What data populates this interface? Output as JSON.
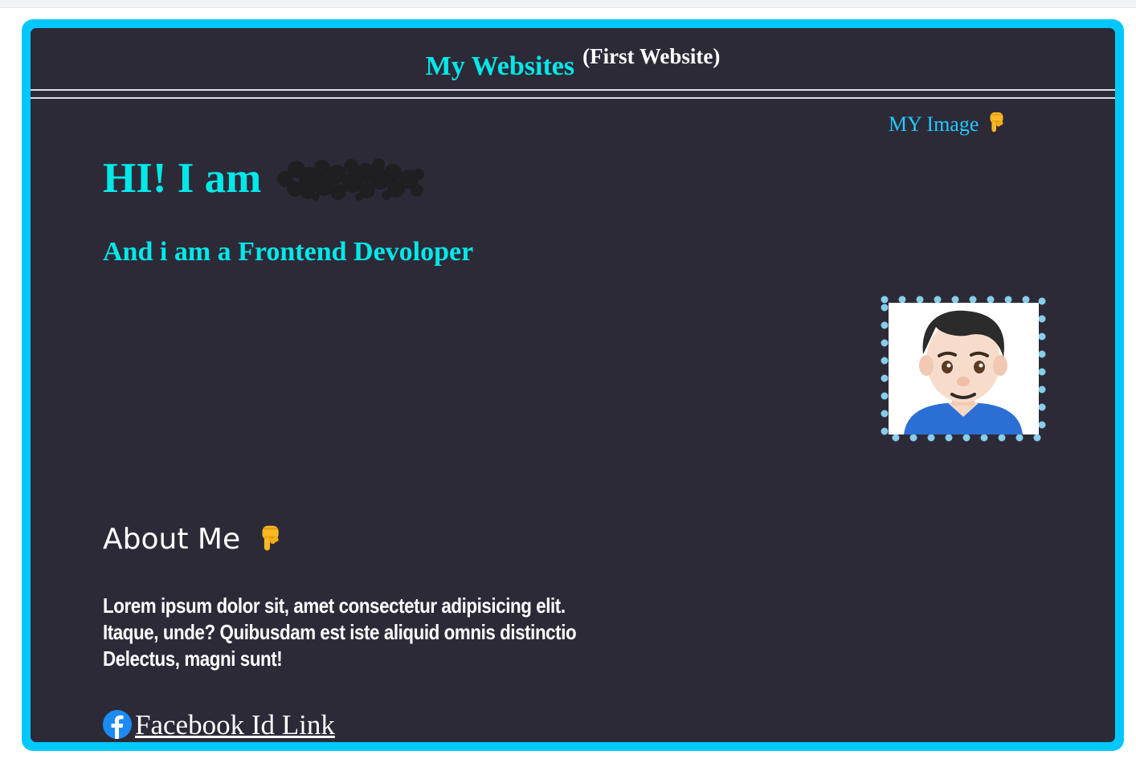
{
  "header": {
    "title": "My Websites",
    "subtitle": "(First Website)"
  },
  "image_section": {
    "label": "MY Image",
    "label_icon": "pointing-down-hand-icon",
    "avatar_icon": "man-emoji-avatar"
  },
  "hero": {
    "greeting": "HI! I am",
    "tagline": "And i am a Frontend Devoloper"
  },
  "about": {
    "title": "About Me",
    "title_icon": "pointing-down-hand-icon",
    "text": "Lorem ipsum dolor sit, amet consectetur adipisicing elit. Itaque, unde? Quibusdam est iste aliquid omnis distinctio Delectus, magni sunt!"
  },
  "links": {
    "facebook_label": "Facebook Id Link",
    "facebook_icon": "facebook-icon"
  },
  "colors": {
    "frame_border": "#00c8ff",
    "panel_background": "#2d2a38",
    "accent_cyan": "#00e8e8",
    "link_blue": "#21c9ff",
    "avatar_dots": "#87ceeb"
  }
}
